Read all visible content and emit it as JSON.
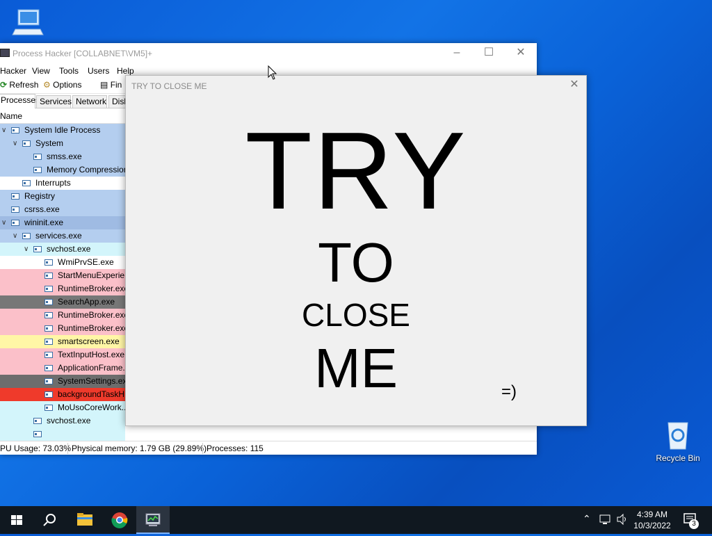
{
  "desktop": {
    "icons": [
      {
        "name": "computer-icon",
        "label": ""
      },
      {
        "name": "recycle-bin-icon",
        "label": "Recycle Bin"
      }
    ]
  },
  "process_hacker": {
    "title": "Process Hacker [COLLABNET\\VM5]+",
    "menu": [
      "Hacker",
      "View",
      "Tools",
      "Users",
      "Help"
    ],
    "toolbar": {
      "refresh": "Refresh",
      "options": "Options",
      "find": "Fin"
    },
    "tabs": [
      "Processes",
      "Services",
      "Network",
      "Disk"
    ],
    "active_tab": "Processes",
    "column_name": "Name",
    "processes": [
      {
        "name": "System Idle Process",
        "color": "#b4ceef",
        "chev": true
      },
      {
        "name": "System",
        "color": "#b4ceef",
        "chev": true
      },
      {
        "name": "smss.exe",
        "color": "#b4ceef",
        "chev": false
      },
      {
        "name": "Memory Compression",
        "color": "#b4ceef",
        "chev": false
      },
      {
        "name": "Interrupts",
        "color": "#ffffff",
        "chev": false
      },
      {
        "name": "Registry",
        "color": "#b4ceef",
        "chev": false
      },
      {
        "name": "csrss.exe",
        "color": "#b4ceef",
        "chev": false
      },
      {
        "name": "wininit.exe",
        "color": "#9fbbe3",
        "chev": true
      },
      {
        "name": "services.exe",
        "color": "#b4ceef",
        "chev": true
      },
      {
        "name": "svchost.exe",
        "color": "#d3f5fb",
        "chev": true
      },
      {
        "name": "WmiPrvSE.exe",
        "color": "#ffffff",
        "chev": false
      },
      {
        "name": "StartMenuExperie...",
        "color": "#fbc0c9",
        "chev": false
      },
      {
        "name": "RuntimeBroker.exe",
        "color": "#fbc0c9",
        "chev": false
      },
      {
        "name": "SearchApp.exe",
        "color": "#777777",
        "chev": false
      },
      {
        "name": "RuntimeBroker.exe",
        "color": "#fbc0c9",
        "chev": false
      },
      {
        "name": "RuntimeBroker.exe",
        "color": "#fbc0c9",
        "chev": false
      },
      {
        "name": "smartscreen.exe",
        "color": "#fff6a6",
        "chev": false
      },
      {
        "name": "TextInputHost.exe",
        "color": "#fbc0c9",
        "chev": false
      },
      {
        "name": "ApplicationFrame...",
        "color": "#fbc0c9",
        "chev": false
      },
      {
        "name": "SystemSettings.exe",
        "color": "#6d6d6d",
        "chev": false
      },
      {
        "name": "backgroundTaskH...",
        "color": "#ef3a2b",
        "chev": false
      },
      {
        "name": "MoUsoCoreWork...",
        "color": "#d3f5fb",
        "chev": false
      },
      {
        "name": "svchost.exe",
        "color": "#d3f5fb",
        "chev": false
      },
      {
        "name": "",
        "color": "#d3f5fb",
        "chev": false
      }
    ],
    "status": {
      "cpu": "PU Usage: 73.03%",
      "memory": "Physical memory: 1.79 GB (29.89%)",
      "processes": "Processes: 115"
    }
  },
  "popup": {
    "title": "TRY TO CLOSE ME",
    "line1": "TRY",
    "line2": "TO",
    "line3": "CLOSE",
    "line4": "ME",
    "smiley": "=)"
  },
  "taskbar": {
    "items": [
      "start-icon",
      "search-icon",
      "file-explorer-icon",
      "chrome-icon",
      "process-hacker-icon"
    ],
    "clock_time": "4:39 AM",
    "clock_date": "10/3/2022",
    "notification_count": "3"
  }
}
